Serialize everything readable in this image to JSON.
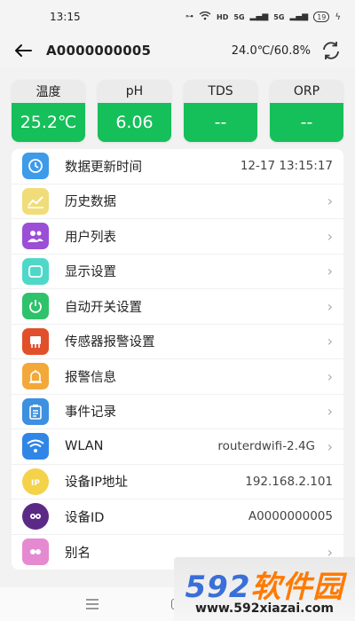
{
  "status_bar": {
    "time": "13:15",
    "network_labels": [
      "HD",
      "5G",
      "5G"
    ],
    "battery": "19"
  },
  "header": {
    "title": "A0000000005",
    "env_readout": "24.0℃/60.8%",
    "back_icon": "arrow-left-icon",
    "refresh_icon": "refresh-icon"
  },
  "sensors": [
    {
      "label": "温度",
      "value": "25.2℃"
    },
    {
      "label": "pH",
      "value": "6.06"
    },
    {
      "label": "TDS",
      "value": "--"
    },
    {
      "label": "ORP",
      "value": "--"
    }
  ],
  "menu": [
    {
      "label": "数据更新时间",
      "value": "12-17 13:15:17",
      "chevron": false,
      "icon": "clock-icon",
      "color": "#3d9be9"
    },
    {
      "label": "历史数据",
      "value": "",
      "chevron": true,
      "icon": "chart-icon",
      "color": "#f0dd7a"
    },
    {
      "label": "用户列表",
      "value": "",
      "chevron": true,
      "icon": "users-icon",
      "color": "#9b4fd6"
    },
    {
      "label": "显示设置",
      "value": "",
      "chevron": true,
      "icon": "display-icon",
      "color": "#4fd8c8"
    },
    {
      "label": "自动开关设置",
      "value": "",
      "chevron": true,
      "icon": "power-icon",
      "color": "#2ec26a"
    },
    {
      "label": "传感器报警设置",
      "value": "",
      "chevron": true,
      "icon": "sensor-icon",
      "color": "#e1502b"
    },
    {
      "label": "报警信息",
      "value": "",
      "chevron": true,
      "icon": "alarm-icon",
      "color": "#f2a93a"
    },
    {
      "label": "事件记录",
      "value": "",
      "chevron": true,
      "icon": "clipboard-icon",
      "color": "#3d8fe0"
    },
    {
      "label": "WLAN",
      "value": "routerdwifi-2.4G",
      "chevron": true,
      "icon": "wifi-icon",
      "color": "#2f86e6"
    },
    {
      "label": "设备IP地址",
      "value": "192.168.2.101",
      "chevron": false,
      "icon": "ip-icon",
      "color": "#f4d24a"
    },
    {
      "label": "设备ID",
      "value": "A0000000005",
      "chevron": false,
      "icon": "device-id-icon",
      "color": "#5b2a86"
    },
    {
      "label": "别名",
      "value": "",
      "chevron": true,
      "icon": "alias-icon",
      "color": "#e58ad0"
    }
  ],
  "watermark": {
    "brand_num": "592",
    "brand_text": "软件园",
    "url": "www.592xiazai.com"
  }
}
